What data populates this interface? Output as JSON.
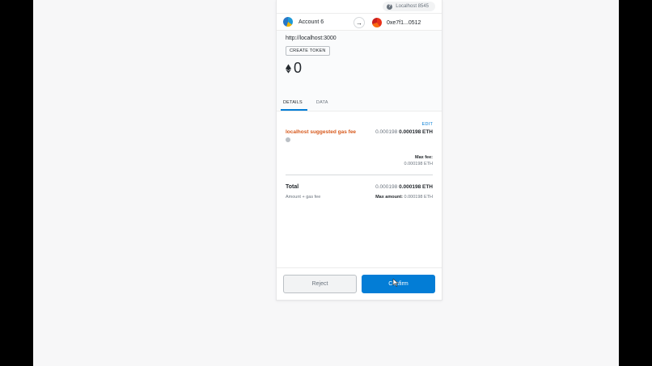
{
  "network": {
    "label": "Localhost 8545",
    "help_icon": "?"
  },
  "accounts": {
    "from_name": "Account 6",
    "to_address": "0xe7f1...0512",
    "arrow_icon": "→"
  },
  "summary": {
    "origin": "http://localhost:3000",
    "method": "CREATE TOKEN",
    "amount": "0"
  },
  "tabs": [
    {
      "label": "DETAILS"
    },
    {
      "label": "DATA"
    }
  ],
  "details": {
    "edit_label": "EDIT",
    "gas_label": "localhost suggested gas fee",
    "gas_value_secondary": "0.000198",
    "gas_value_primary": "0.000198 ETH",
    "max_fee_label": "Max fee:",
    "max_fee_value": "0.000198 ETH",
    "total_label": "Total",
    "total_value_secondary": "0.000198",
    "total_value_primary": "0.000198 ETH",
    "total_sub_label": "Amount + gas fee",
    "max_amount_label": "Max amount:",
    "max_amount_value": "0.000198 ETH"
  },
  "footer": {
    "reject_label": "Reject",
    "confirm_label": "Confirm"
  },
  "colors": {
    "primary": "#037dd6",
    "gas_label": "#d7591c",
    "text": "#24292e",
    "muted": "#6a737d"
  }
}
